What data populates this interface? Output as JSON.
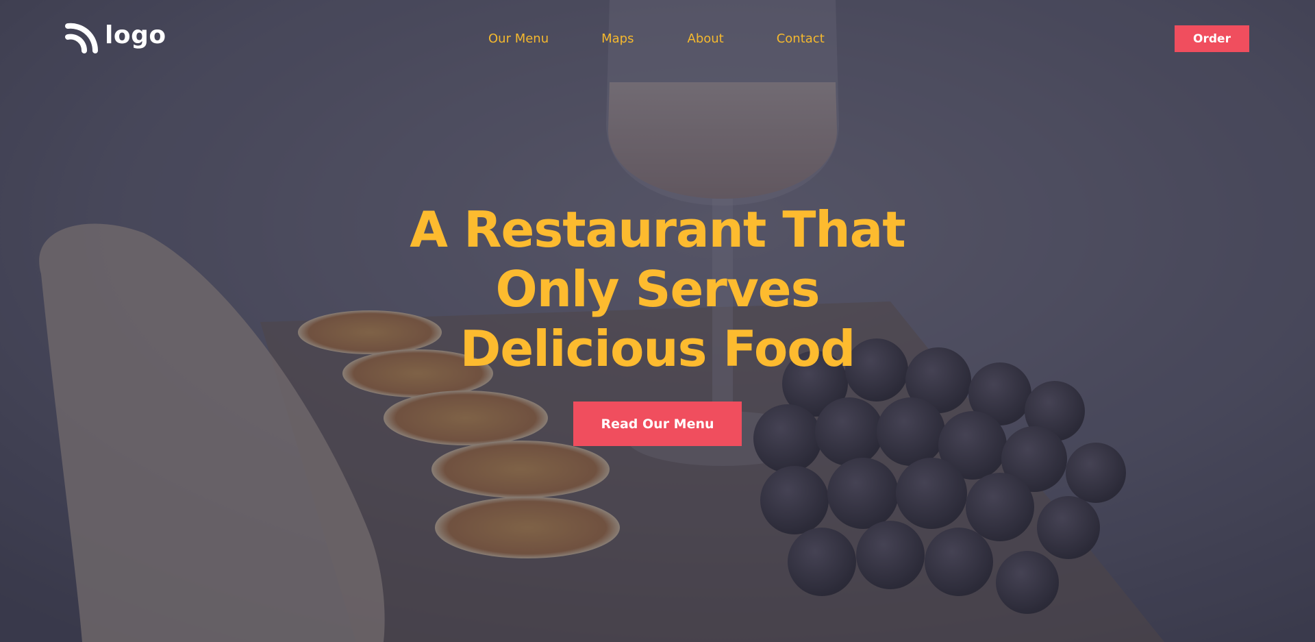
{
  "brand": {
    "logo_text": "logo",
    "logo_icon": "signal-arcs-icon"
  },
  "nav": {
    "items": [
      {
        "label": "Our Menu"
      },
      {
        "label": "Maps"
      },
      {
        "label": "About"
      },
      {
        "label": "Contact"
      }
    ],
    "order_label": "Order"
  },
  "hero": {
    "headline_lines": [
      "A Restaurant That",
      "Only Serves",
      "Delicious Food"
    ],
    "cta_label": "Read Our Menu"
  },
  "colors": {
    "accent_yellow": "#fdbb2f",
    "accent_red": "#f04e5e",
    "overlay": "#343446"
  }
}
